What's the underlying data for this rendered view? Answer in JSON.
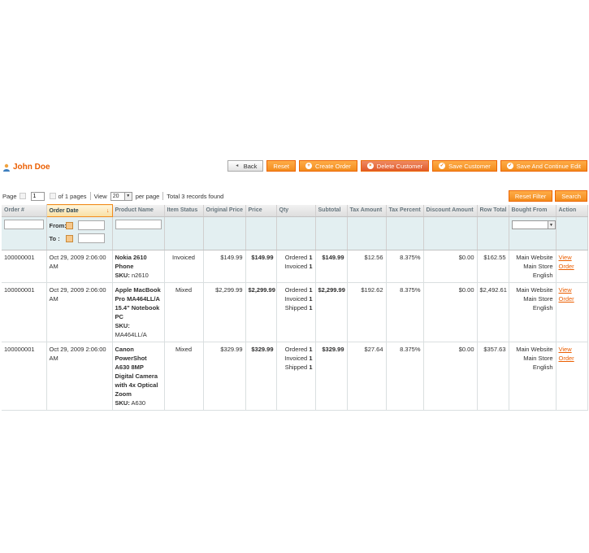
{
  "customer": {
    "name": "John Doe"
  },
  "buttons": {
    "back": "Back",
    "reset": "Reset",
    "create_order": "Create Order",
    "delete_customer": "Delete Customer",
    "save_customer": "Save Customer",
    "save_continue": "Save And Continue Edit"
  },
  "pager": {
    "page_label": "Page",
    "page_value": "1",
    "of_pages": "of 1 pages",
    "view_label": "View",
    "view_value": "20",
    "per_page": "per page",
    "total": "Total 3 records found",
    "reset_filter": "Reset Filter",
    "search": "Search"
  },
  "columns": [
    "Order #",
    "Order Date",
    "Product Name",
    "Item Status",
    "Original Price",
    "Price",
    "Qty",
    "Subtotal",
    "Tax Amount",
    "Tax Percent",
    "Discount Amount",
    "Row Total",
    "Bought From",
    "Action"
  ],
  "filters": {
    "from": "From:",
    "to": "To :"
  },
  "rows": [
    {
      "order": "100000001",
      "date": "Oct 29, 2009 2:06:00 AM",
      "product": "Nokia 2610 Phone",
      "sku_label": "SKU:",
      "sku": "n2610",
      "status": "Invoiced",
      "original_price": "$149.99",
      "price": "$149.99",
      "qty": [
        {
          "label": "Ordered",
          "value": "1"
        },
        {
          "label": "Invoiced",
          "value": "1"
        }
      ],
      "subtotal": "$149.99",
      "tax_amount": "$12.56",
      "tax_percent": "8.375%",
      "discount": "$0.00",
      "row_total": "$162.55",
      "bought_from": [
        "Main Website",
        "Main Store",
        "English"
      ],
      "action": [
        "View",
        "Order"
      ]
    },
    {
      "order": "100000001",
      "date": "Oct 29, 2009 2:06:00 AM",
      "product": "Apple MacBook Pro MA464LL/A 15.4\" Notebook PC",
      "sku_label": "SKU:",
      "sku": "MA464LL/A",
      "status": "Mixed",
      "original_price": "$2,299.99",
      "price": "$2,299.99",
      "qty": [
        {
          "label": "Ordered",
          "value": "1"
        },
        {
          "label": "Invoiced",
          "value": "1"
        },
        {
          "label": "Shipped",
          "value": "1"
        }
      ],
      "subtotal": "$2,299.99",
      "tax_amount": "$192.62",
      "tax_percent": "8.375%",
      "discount": "$0.00",
      "row_total": "$2,492.61",
      "bought_from": [
        "Main Website",
        "Main Store",
        "English"
      ],
      "action": [
        "View",
        "Order"
      ]
    },
    {
      "order": "100000001",
      "date": "Oct 29, 2009 2:06:00 AM",
      "product": "Canon PowerShot A630 8MP Digital Camera with 4x Optical Zoom",
      "sku_label": "SKU:",
      "sku": "A630",
      "status": "Mixed",
      "original_price": "$329.99",
      "price": "$329.99",
      "qty": [
        {
          "label": "Ordered",
          "value": "1"
        },
        {
          "label": "Invoiced",
          "value": "1"
        },
        {
          "label": "Shipped",
          "value": "1"
        }
      ],
      "subtotal": "$329.99",
      "tax_amount": "$27.64",
      "tax_percent": "8.375%",
      "discount": "$0.00",
      "row_total": "$357.63",
      "bought_from": [
        "Main Website",
        "Main Store",
        "English"
      ],
      "action": [
        "View",
        "Order"
      ]
    }
  ],
  "colors": {
    "accent": "#eb5e00",
    "button": "#f28c1e",
    "filter_bg": "#e3eff1"
  }
}
